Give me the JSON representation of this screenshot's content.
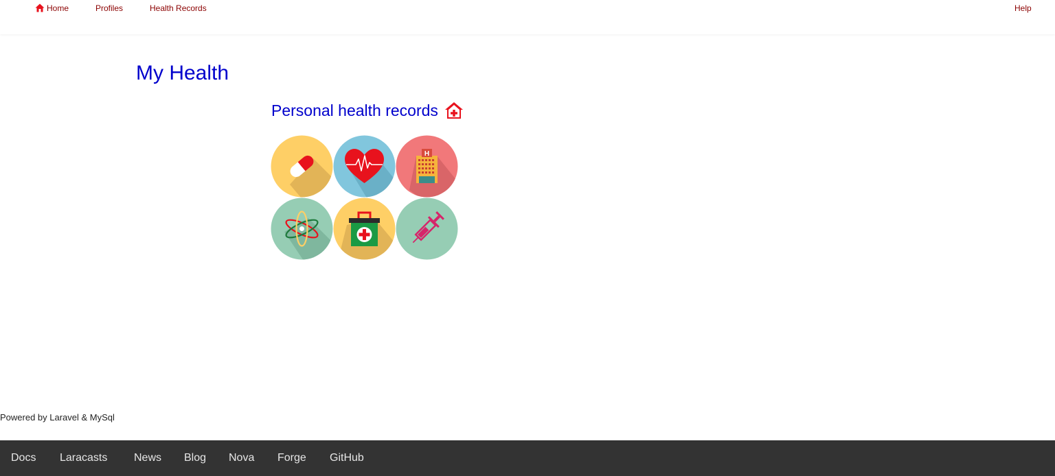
{
  "nav": {
    "home": "Home",
    "profiles": "Profiles",
    "health_records": "Health Records",
    "help": "Help"
  },
  "page_title": "My Health",
  "section_title": "Personal health records",
  "tiles": [
    {
      "icon": "pill-icon",
      "color": "#fecf66"
    },
    {
      "icon": "heartbeat-icon",
      "color": "#81c6dd"
    },
    {
      "icon": "hospital-icon",
      "color": "#f1787a"
    },
    {
      "icon": "atom-icon",
      "color": "#96cdb4"
    },
    {
      "icon": "first-aid-kit-icon",
      "color": "#fecf66"
    },
    {
      "icon": "syringe-icon",
      "color": "#96cdb4"
    }
  ],
  "powered_by": "Powered by Laravel & MySql",
  "footer": {
    "links": [
      "Docs",
      "Laracasts",
      "News",
      "Blog",
      "Nova",
      "Forge",
      "GitHub"
    ]
  },
  "colors": {
    "nav_link": "#8b0000",
    "heading": "#0000cc",
    "footer_bg": "#333333",
    "house_icon": "#e8121d"
  }
}
